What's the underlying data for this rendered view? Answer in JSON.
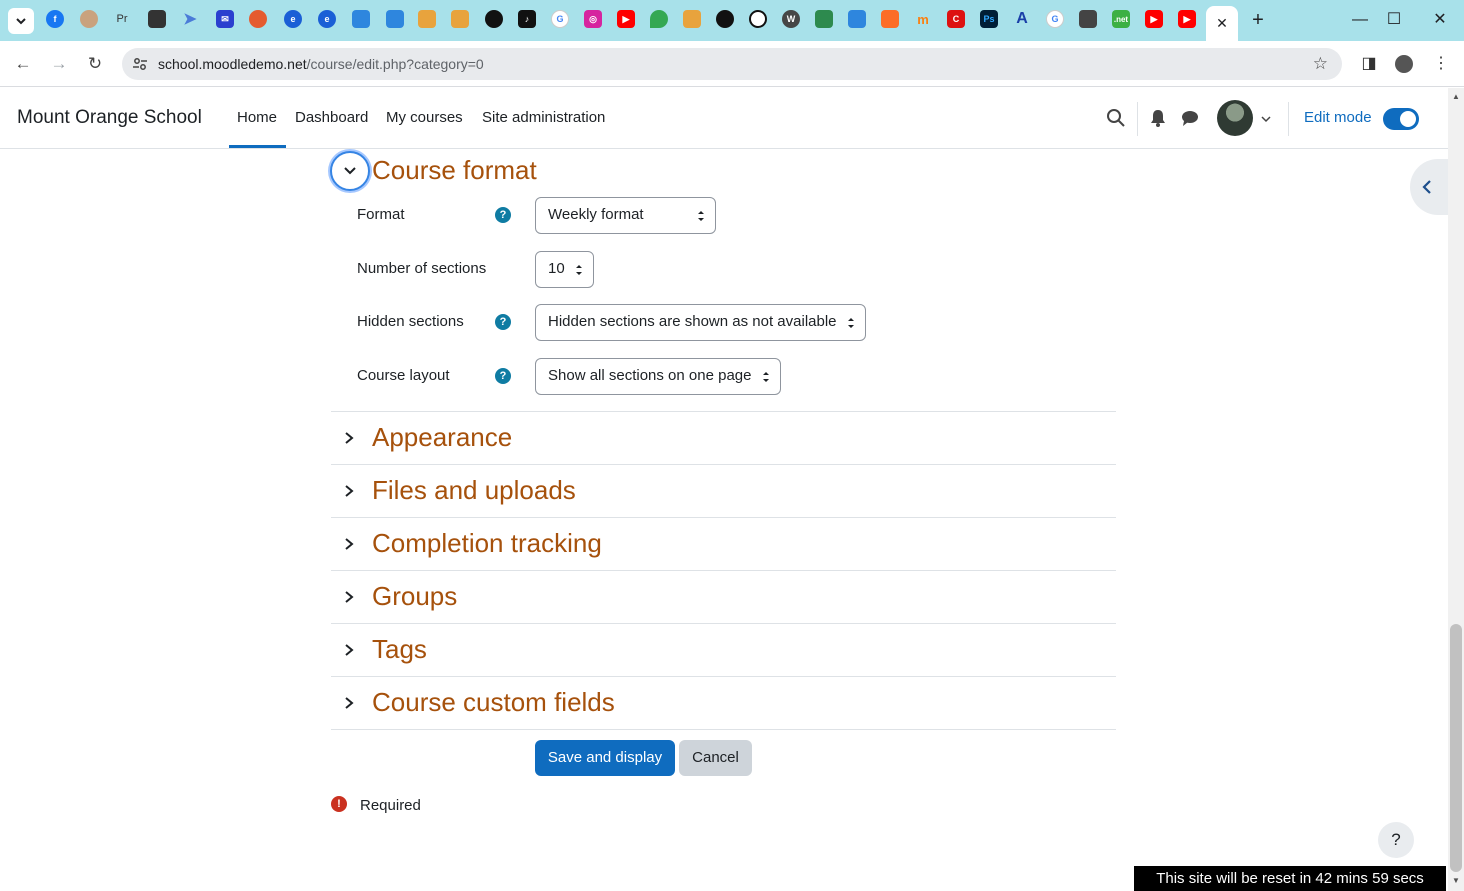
{
  "browser": {
    "url_domain": "school.moodledemo.net",
    "url_path": "/course/edit.php?category=0",
    "active_tab_close": "✕",
    "new_tab": "+",
    "pinned_tabs": [
      "facebook-icon",
      "profile-icon",
      "pr-icon",
      "app-icon",
      "arrow-icon",
      "mail-icon",
      "bird-icon",
      "circle-e-icon",
      "circle-e-icon",
      "news-icon",
      "news-icon",
      "stack-icon",
      "stack-icon",
      "github-icon",
      "tiktok-icon",
      "google-icon",
      "instagram-icon",
      "youtube-icon",
      "maps-icon",
      "stack-icon",
      "github-icon",
      "compass-icon",
      "wordpress-icon",
      "robot-icon",
      "news-icon",
      "gitlab-icon",
      "moodle-icon",
      "c-icon",
      "ps-icon",
      "a-icon",
      "google-icon",
      "cat-icon",
      "net-icon",
      "youtube-icon",
      "youtube-icon"
    ],
    "pinned_labels": {
      "pr": "Pr",
      "ps": "Ps",
      "c": "C",
      "net": ".net"
    }
  },
  "navbar": {
    "brand": "Mount Orange School",
    "links": [
      "Home",
      "Dashboard",
      "My courses",
      "Site administration"
    ],
    "edit_mode_label": "Edit mode"
  },
  "course_format": {
    "title": "Course format",
    "fields": [
      {
        "label": "Format",
        "value": "Weekly format",
        "help": true
      },
      {
        "label": "Number of sections",
        "value": "10",
        "help": false
      },
      {
        "label": "Hidden sections",
        "value": "Hidden sections are shown as not available",
        "help": true
      },
      {
        "label": "Course layout",
        "value": "Show all sections on one page",
        "help": true
      }
    ],
    "help_glyph": "?"
  },
  "sections": [
    "Appearance",
    "Files and uploads",
    "Completion tracking",
    "Groups",
    "Tags",
    "Course custom fields"
  ],
  "buttons": {
    "save": "Save and display",
    "cancel": "Cancel"
  },
  "required": {
    "label": "Required",
    "glyph": "!"
  },
  "help_button": "?",
  "reset_banner": "This site will be reset in 42 mins 59 secs",
  "colors": {
    "accent": "#0f6cbf",
    "section_title": "#a6510c",
    "help": "#0f7ca3",
    "required": "#ca3120",
    "tabbar": "#a8e1ea"
  }
}
